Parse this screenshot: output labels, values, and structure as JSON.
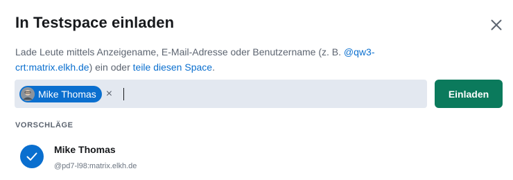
{
  "dialog": {
    "title": "In Testspace einladen",
    "close_icon": "close-icon"
  },
  "description": {
    "text_before": "Lade Leute mittels Anzeigename, E-Mail-Adresse oder Benutzername (z. B. ",
    "example_link": "@qw3-crt:matrix.elkh.de",
    "text_middle": ") ein oder ",
    "share_link": "teile diesen Space",
    "text_after": "."
  },
  "invite_field": {
    "selected_user": {
      "name": "Mike Thomas",
      "avatar_icon": "user-avatar",
      "remove_icon": "close-icon",
      "remove_glyph": "×"
    },
    "value": ""
  },
  "invite_button": {
    "label": "Einladen"
  },
  "suggestions": {
    "header": "VORSCHLÄGE",
    "items": [
      {
        "name": "Mike Thomas",
        "user_id": "@pd7-l98:matrix.elkh.de",
        "selected": true,
        "icon": "checkmark-icon"
      }
    ]
  },
  "colors": {
    "accent": "#0a6fcf",
    "invite_button": "#0b7a5c",
    "field_bg": "#e3e8f0",
    "secondary_text": "#5c6470"
  }
}
